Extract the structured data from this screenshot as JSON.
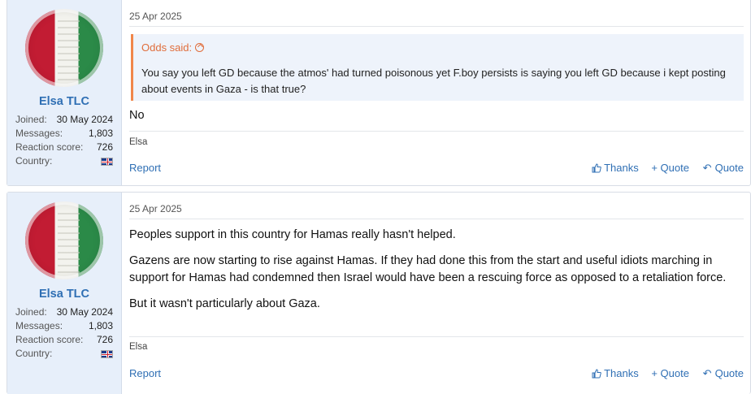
{
  "posts": [
    {
      "user": {
        "name": "Elsa TLC",
        "joined_label": "Joined:",
        "joined": "30 May 2024",
        "messages_label": "Messages:",
        "messages": "1,803",
        "reaction_label": "Reaction score:",
        "reaction": "726",
        "country_label": "Country:"
      },
      "date": "25 Apr 2025",
      "quote": {
        "author": "Odds said:",
        "text": "You say you left GD because the atmos' had turned poisonous yet F.boy persists is saying you left GD because i kept posting about events in Gaza - is that true?"
      },
      "paragraphs": [
        "No"
      ],
      "signature": "Elsa",
      "report": "Report",
      "thanks": "Thanks",
      "quote_add": "+ Quote",
      "reply_quote": "Quote"
    },
    {
      "user": {
        "name": "Elsa TLC",
        "joined_label": "Joined:",
        "joined": "30 May 2024",
        "messages_label": "Messages:",
        "messages": "1,803",
        "reaction_label": "Reaction score:",
        "reaction": "726",
        "country_label": "Country:"
      },
      "date": "25 Apr 2025",
      "paragraphs": [
        "Peoples support in this country for Hamas really hasn't helped.",
        "Gazens are now starting to rise against Hamas. If they had done this from the start and useful idiots marching in support for Hamas had condemned then Israel would have been a rescuing force as opposed to a retaliation force.",
        "But it wasn't particularly about Gaza."
      ],
      "signature": "Elsa",
      "report": "Report",
      "thanks": "Thanks",
      "quote_add": "+ Quote",
      "reply_quote": "Quote"
    }
  ],
  "colors": {
    "link": "#2f6fb4",
    "quote_accent": "#e06d3b",
    "sidebar_bg": "#e7effa"
  }
}
